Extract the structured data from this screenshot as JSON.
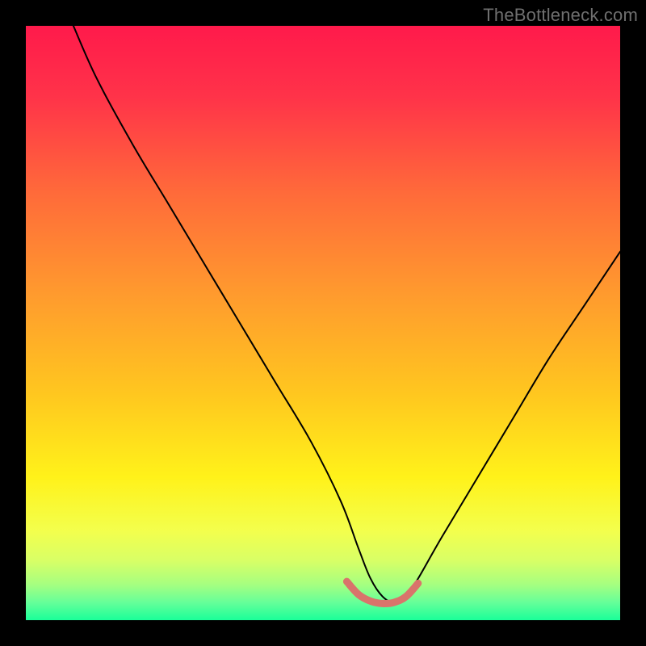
{
  "watermark": "TheBottleneck.com",
  "chart_data": {
    "type": "line",
    "title": "",
    "xlabel": "",
    "ylabel": "",
    "xlim": [
      0,
      100
    ],
    "ylim": [
      0,
      100
    ],
    "notes": "Vertical gradient background from red (top) through orange/yellow to green (bottom). A black V-shaped curve descends steeply from the top-left, flattens near the bottom center (~x 55–65), then rises toward the upper-right. A short pink/coral segment traces the curve along the flat bottom portion.",
    "series": [
      {
        "name": "bottleneck-curve",
        "color": "#000000",
        "x": [
          8,
          12,
          18,
          24,
          30,
          36,
          42,
          48,
          53,
          56,
          58,
          60,
          62,
          64,
          66,
          70,
          76,
          82,
          88,
          94,
          100
        ],
        "values": [
          100,
          91,
          80,
          70,
          60,
          50,
          40,
          30,
          20,
          12,
          7,
          4,
          3,
          4,
          7,
          14,
          24,
          34,
          44,
          53,
          62
        ]
      },
      {
        "name": "highlight-segment",
        "color": "#d9746b",
        "x": [
          54,
          56,
          58,
          60,
          62,
          64,
          66
        ],
        "values": [
          6.5,
          4.3,
          3.2,
          2.8,
          3.0,
          4.0,
          6.2
        ]
      }
    ],
    "gradient_stops": [
      {
        "offset": 0.0,
        "color": "#ff1a4b"
      },
      {
        "offset": 0.12,
        "color": "#ff3349"
      },
      {
        "offset": 0.28,
        "color": "#ff6a3a"
      },
      {
        "offset": 0.45,
        "color": "#ff9a2e"
      },
      {
        "offset": 0.62,
        "color": "#ffc71f"
      },
      {
        "offset": 0.76,
        "color": "#fff21a"
      },
      {
        "offset": 0.85,
        "color": "#f3ff4d"
      },
      {
        "offset": 0.9,
        "color": "#d8ff66"
      },
      {
        "offset": 0.94,
        "color": "#a6ff80"
      },
      {
        "offset": 0.97,
        "color": "#66ff99"
      },
      {
        "offset": 1.0,
        "color": "#1aff99"
      }
    ]
  }
}
